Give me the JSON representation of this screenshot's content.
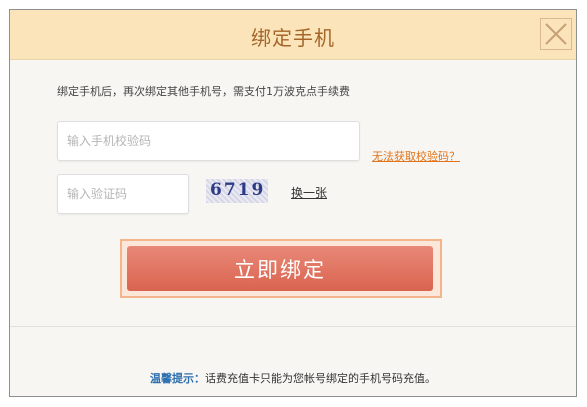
{
  "dialog": {
    "title": "绑定手机",
    "close_icon": "close-icon",
    "notice": "绑定手机后，再次绑定其他手机号，需支付1万波克点手续费",
    "phone_code_placeholder": "输入手机校验码",
    "no_code_link": "无法获取校验码？",
    "verify_code_placeholder": "输入验证码",
    "captcha_text": "6719",
    "refresh_link": "换一张",
    "submit_label": "立即绑定",
    "tips_label": "温馨提示：",
    "tips_text": "话费充值卡只能为您帐号绑定的手机号码充值。"
  },
  "colors": {
    "header_bg": "#fbe4b9",
    "title": "#a5662a",
    "button": "#d9644f",
    "link": "#e0731b",
    "tips_label": "#2d6fb0"
  }
}
